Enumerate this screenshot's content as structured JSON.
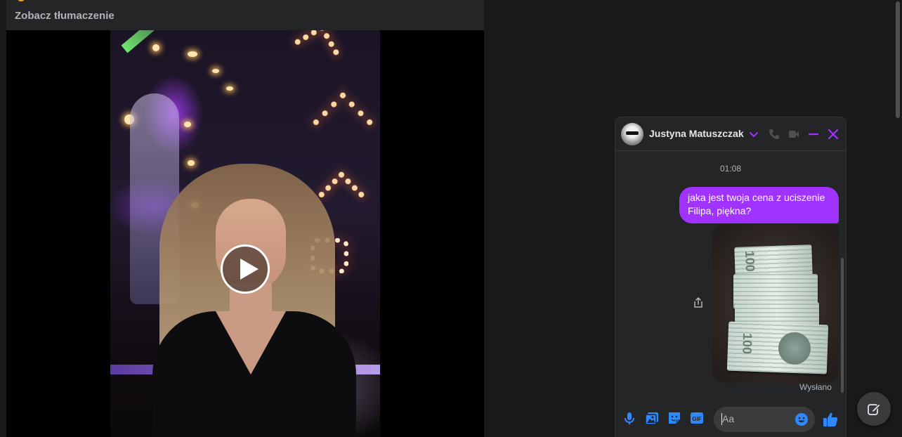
{
  "post": {
    "translate_link": "Zobacz tłumaczenie",
    "video": {
      "state": "paused"
    }
  },
  "chat": {
    "contact_name": "Justyna Matuszczak",
    "timestamp": "01:08",
    "messages": [
      {
        "type": "text",
        "direction": "outgoing",
        "text": "jaka jest twoja cena z uciszenie Filipa, piękna?"
      },
      {
        "type": "image",
        "direction": "outgoing",
        "content_visible": "stack of 100 złoty banknotes"
      }
    ],
    "bill_denomination": "100",
    "sent_status": "Wysłano",
    "input_placeholder": "Aa",
    "accent_color": "#a033ff",
    "icon_color": "#2e89ff"
  },
  "icons": {
    "header": [
      "chevron-down-icon",
      "phone-icon",
      "video-camera-icon",
      "minimize-icon",
      "close-icon"
    ],
    "toolbar": [
      "microphone-icon",
      "photo-icon",
      "sticker-icon",
      "gif-icon",
      "emoji-icon",
      "thumbs-up-icon"
    ],
    "other": [
      "share-icon",
      "play-icon",
      "compose-icon"
    ]
  }
}
